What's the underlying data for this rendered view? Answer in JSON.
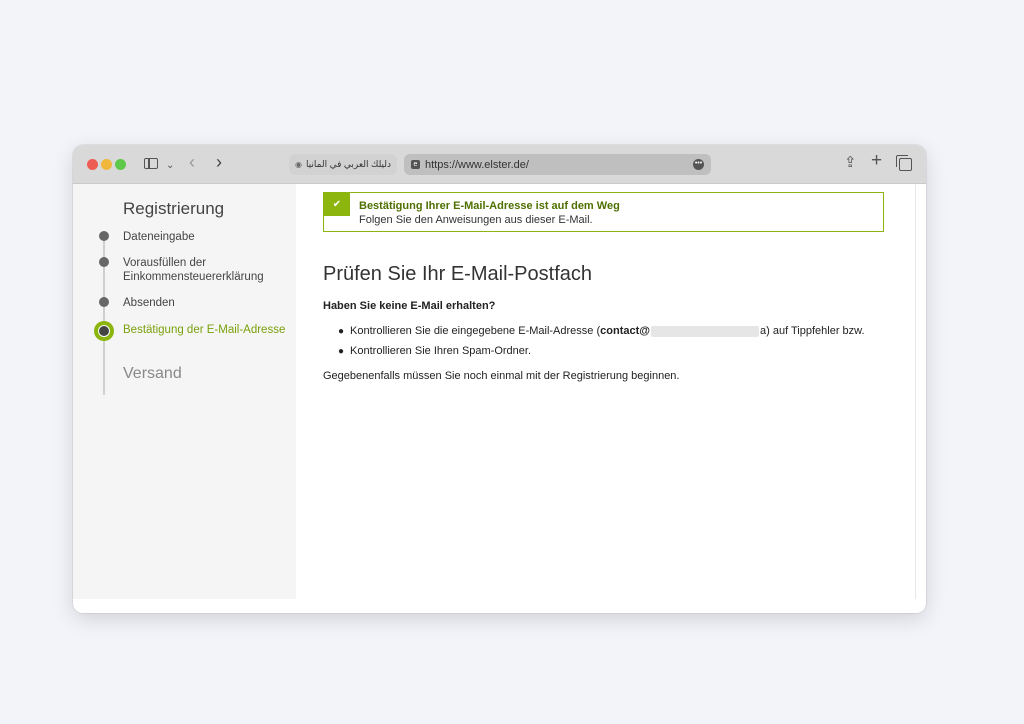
{
  "browser": {
    "tab_title": "دليلك العربي في المانيا",
    "url": "https://www.elster.de/"
  },
  "sidebar": {
    "heading": "Registrierung",
    "steps": [
      {
        "label": "Dateneingabe"
      },
      {
        "label_line1": "Vorausfüllen der",
        "label_line2": "Einkommensteuererklärung"
      },
      {
        "label": "Absenden"
      },
      {
        "label": "Bestätigung der E-Mail-Adresse",
        "active": true
      }
    ],
    "next_section": "Versand"
  },
  "alert": {
    "title": "Bestätigung Ihrer E-Mail-Adresse ist auf dem Weg",
    "text": "Folgen Sie den Anweisungen aus dieser E-Mail.",
    "color": "#8cb50d"
  },
  "main": {
    "title": "Prüfen Sie Ihr E-Mail-Postfach",
    "subheading": "Haben Sie keine E-Mail erhalten?",
    "bullet1_prefix": "Kontrollieren Sie die eingegebene E-Mail-Adresse (",
    "bullet1_email": "contact@",
    "bullet1_email_end": "a",
    "bullet1_suffix": ") auf Tippfehler bzw.",
    "bullet2": "Kontrollieren Sie Ihren Spam-Ordner.",
    "footer": "Gegebenenfalls müssen Sie noch einmal mit der Registrierung beginnen."
  },
  "icons": [
    "sidebar-icon",
    "chevron-down-icon",
    "back-icon",
    "forward-icon",
    "share-icon",
    "plus-icon",
    "tabs-icon",
    "more-icon",
    "check-icon"
  ]
}
